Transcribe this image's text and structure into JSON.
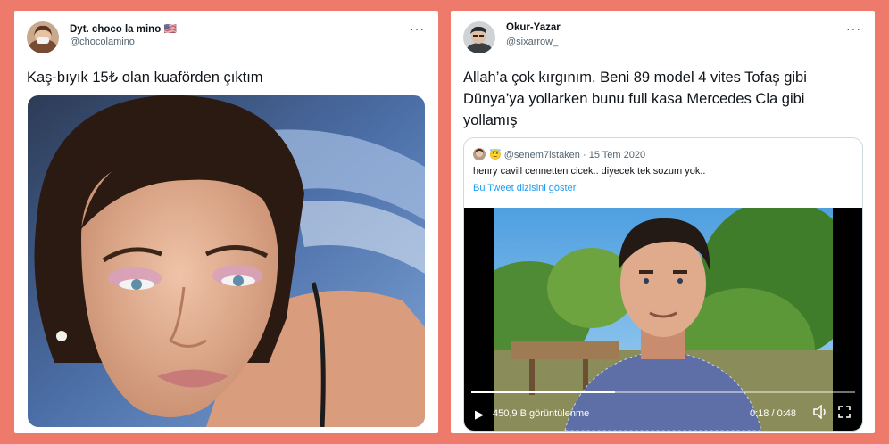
{
  "tweet1": {
    "display_name": "Dyt. choco la mino",
    "flag": "🇺🇸",
    "handle": "@chocolamino",
    "more_label": "···",
    "text": "Kaş-bıyık 15₺ olan kuaförden çıktım"
  },
  "tweet2": {
    "display_name": "Okur-Yazar",
    "handle": "@sixarrow_",
    "more_label": "···",
    "text_lines": [
      "Allah’a çok kırgınım. Beni 89 model 4 vites Tofaş gibi",
      "Dünya’ya yollarken bunu full kasa Mercedes Cla gibi",
      "yollamış"
    ],
    "quote": {
      "emoji": "😇",
      "handle": "@senem7istaken",
      "separator": "·",
      "date": "15 Tem 2020",
      "text": "henry cavill cennetten cicek.. diyecek tek sozum yok..",
      "thread_link": "Bu Tweet dizisini göster",
      "video": {
        "views": "450,9 B görüntülenme",
        "time": "0:18 / 0:48",
        "progress": 0.375
      }
    }
  },
  "colors": {
    "background": "#ee7a6b",
    "link": "#1d9bf0",
    "secondary_text": "#536471"
  }
}
